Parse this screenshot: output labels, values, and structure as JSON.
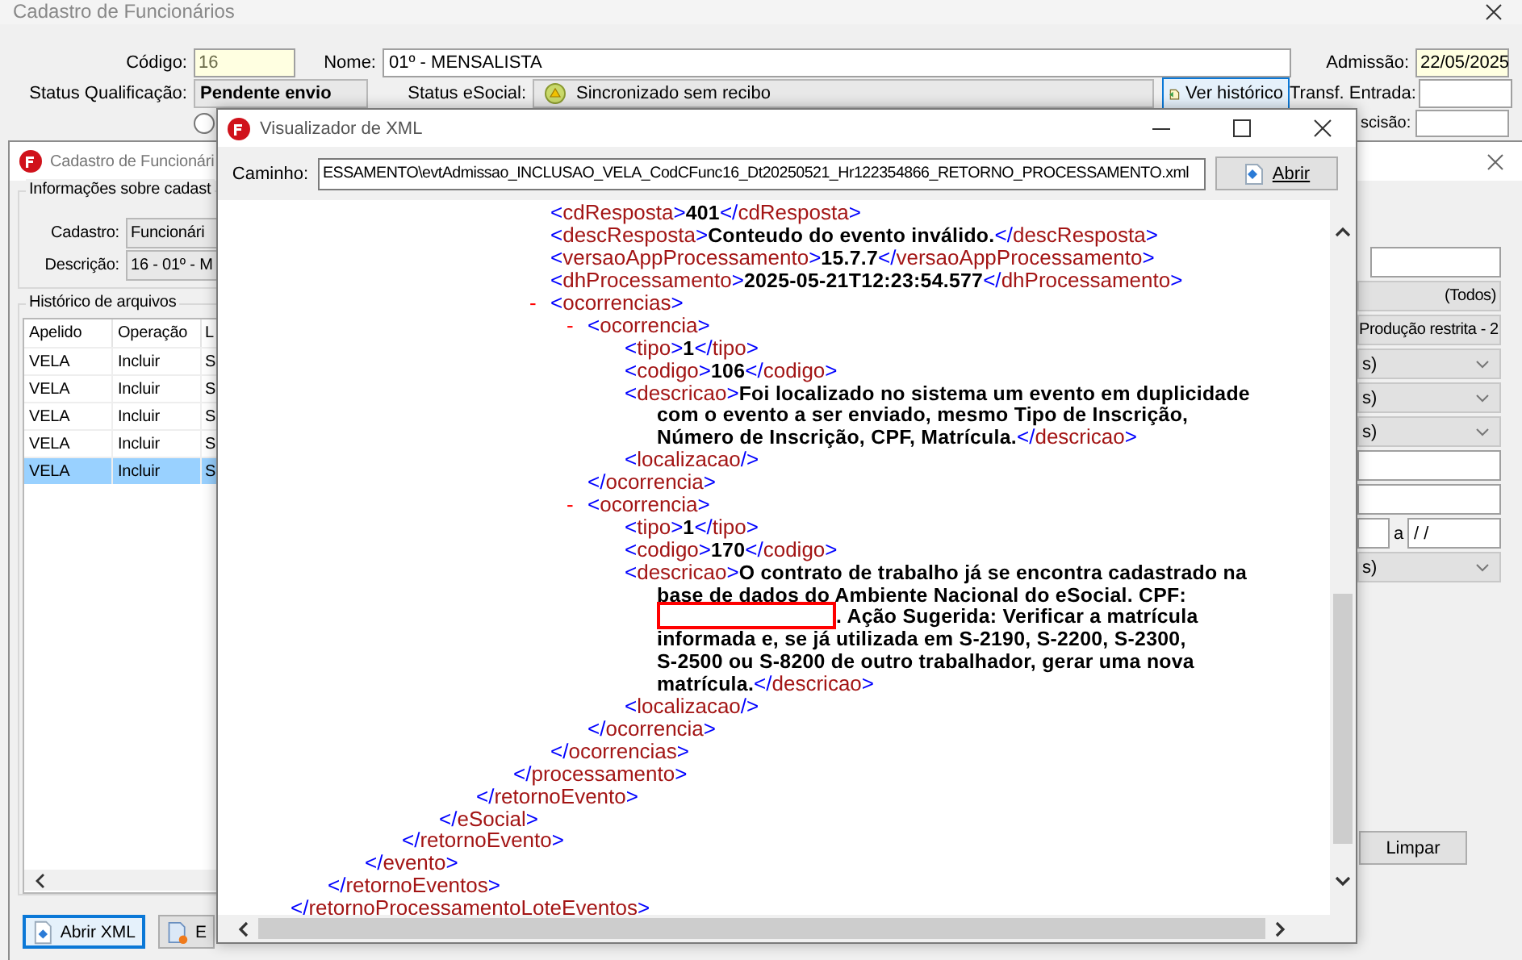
{
  "top_window": {
    "title": "Cadastro de Funcionários",
    "codigo": {
      "label": "Código:",
      "value": "16"
    },
    "nome": {
      "label": "Nome:",
      "value": "01º - MENSALISTA"
    },
    "admissao": {
      "label": "Admissão:",
      "value": "22/05/2025"
    },
    "status_qualificacao": {
      "label": "Status Qualificação:",
      "value": "Pendente envio"
    },
    "status_esocial": {
      "label": "Status eSocial:",
      "value": "Sincronizado sem recibo"
    },
    "history_button": "Ver histórico",
    "transf_entrada": {
      "label": "Transf. Entrada:"
    },
    "rescisao": {
      "label": "scisão:"
    },
    "option_radio": {
      "selected": false
    }
  },
  "cadastro_window": {
    "title": "Cadastro de Funcionári",
    "group_title": "Informações sobre cadast",
    "cadastro": {
      "label": "Cadastro:",
      "value": "Funcionári"
    },
    "descricao": {
      "label": "Descrição:",
      "value": "16 - 01º - M"
    },
    "history_title": "Histórico de arquivos",
    "table": {
      "columns": [
        "Apelido",
        "Operação",
        "L"
      ],
      "rows": [
        {
          "cells": [
            "VELA",
            "Incluir",
            "S"
          ],
          "selected": false
        },
        {
          "cells": [
            "VELA",
            "Incluir",
            "S"
          ],
          "selected": false
        },
        {
          "cells": [
            "VELA",
            "Incluir",
            "S"
          ],
          "selected": false
        },
        {
          "cells": [
            "VELA",
            "Incluir",
            "S"
          ],
          "selected": false
        },
        {
          "cells": [
            "VELA",
            "Incluir",
            "S"
          ],
          "selected": true
        }
      ]
    },
    "filters": [
      {
        "kind": "field"
      },
      {
        "kind": "select",
        "value": "(Todos)"
      },
      {
        "kind": "select",
        "value": "Produção restrita - 2"
      },
      {
        "kind": "dropdown",
        "value": "s)"
      },
      {
        "kind": "dropdown",
        "value": "s)"
      },
      {
        "kind": "dropdown",
        "value": "s)"
      },
      {
        "kind": "field"
      },
      {
        "kind": "field"
      },
      {
        "kind": "range",
        "separator": "a",
        "value": "/ /"
      },
      {
        "kind": "dropdown",
        "value": "s)"
      }
    ],
    "clear_button": "Limpar",
    "open_xml_button": "Abrir XML",
    "export_button": "E"
  },
  "xml_viewer": {
    "title": "Visualizador de XML",
    "path_label": "Caminho:",
    "path": "ESSAMENTO\\evtAdmissao_INCLUSAO_VELA_CodCFunc16_Dt20250521_Hr122354866_RETORNO_PROCESSAMENTO.xml",
    "open_button": "Abrir",
    "tree": {
      "kind": "tail",
      "close": "</retornoProcessamentoLoteEventos>",
      "children": [
        {
          "kind": "tail",
          "close": "</retornoEventos>",
          "children": [
            {
              "kind": "tail",
              "close": "</evento>",
              "children": [
                {
                  "kind": "tail",
                  "close": "</retornoEvento>",
                  "children": [
                    {
                      "kind": "tail",
                      "close": "</eSocial>",
                      "children": [
                        {
                          "kind": "tail",
                          "close": "</retornoEvento>",
                          "children": [
                            {
                              "kind": "tail",
                              "close": "</processamento>",
                              "children": [
                                {
                                  "kind": "leaf",
                                  "open": "<cdResposta>",
                                  "text": "401",
                                  "close": "</cdResposta>"
                                },
                                {
                                  "kind": "leaf",
                                  "open": "<descResposta>",
                                  "text": "Conteudo do evento inválido.",
                                  "close": "</descResposta>"
                                },
                                {
                                  "kind": "leaf",
                                  "open": "<versaoAppProcessamento>",
                                  "text": "15.7.7",
                                  "close": "</versaoAppProcessamento>"
                                },
                                {
                                  "kind": "leaf",
                                  "open": "<dhProcessamento>",
                                  "text": "2025-05-21T12:23:54.577",
                                  "close": "</dhProcessamento>"
                                },
                                {
                                  "kind": "element",
                                  "toggle": "-",
                                  "open": "<ocorrencias>",
                                  "close": "</ocorrencias>",
                                  "children": [
                                    {
                                      "kind": "element",
                                      "toggle": "-",
                                      "open": "<ocorrencia>",
                                      "close": "</ocorrencia>",
                                      "children": [
                                        {
                                          "kind": "leaf",
                                          "open": "<tipo>",
                                          "text": "1",
                                          "close": "</tipo>"
                                        },
                                        {
                                          "kind": "leaf",
                                          "open": "<codigo>",
                                          "text": "106",
                                          "close": "</codigo>"
                                        },
                                        {
                                          "kind": "wrapped",
                                          "open": "<descricao>",
                                          "close": "</descricao>",
                                          "lines": [
                                            {
                                              "text": "Foi localizado no sistema um evento em duplicidade",
                                              "redacted": false
                                            },
                                            {
                                              "text": "com o evento a ser enviado, mesmo Tipo de Inscrição,",
                                              "redacted": false
                                            },
                                            {
                                              "text": "Número de Inscrição, CPF, Matrícula.",
                                              "redacted": false
                                            }
                                          ]
                                        },
                                        {
                                          "kind": "empty",
                                          "open": "<localizacao/>"
                                        }
                                      ]
                                    },
                                    {
                                      "kind": "element",
                                      "toggle": "-",
                                      "open": "<ocorrencia>",
                                      "close": "</ocorrencia>",
                                      "children": [
                                        {
                                          "kind": "leaf",
                                          "open": "<tipo>",
                                          "text": "1",
                                          "close": "</tipo>"
                                        },
                                        {
                                          "kind": "leaf",
                                          "open": "<codigo>",
                                          "text": "170",
                                          "close": "</codigo>"
                                        },
                                        {
                                          "kind": "wrapped",
                                          "open": "<descricao>",
                                          "close": "</descricao>",
                                          "lines": [
                                            {
                                              "text": "O contrato de trabalho já se encontra cadastrado na",
                                              "redacted": false
                                            },
                                            {
                                              "text": "base de dados do Ambiente Nacional do eSocial. CPF:",
                                              "redacted": false
                                            },
                                            {
                                              "text": ". Ação Sugerida: Verificar a matrícula",
                                              "redacted": true
                                            },
                                            {
                                              "text": "informada e, se já utilizada em S-2190, S-2200, S-2300,",
                                              "redacted": false
                                            },
                                            {
                                              "text": "S-2500 ou S-8200 de outro trabalhador, gerar uma nova",
                                              "redacted": false
                                            },
                                            {
                                              "text": "matrícula.",
                                              "redacted": false
                                            }
                                          ]
                                        },
                                        {
                                          "kind": "empty",
                                          "open": "<localizacao/>"
                                        }
                                      ]
                                    }
                                  ]
                                }
                              ]
                            }
                          ]
                        }
                      ]
                    }
                  ]
                }
              ]
            }
          ]
        }
      ]
    }
  }
}
